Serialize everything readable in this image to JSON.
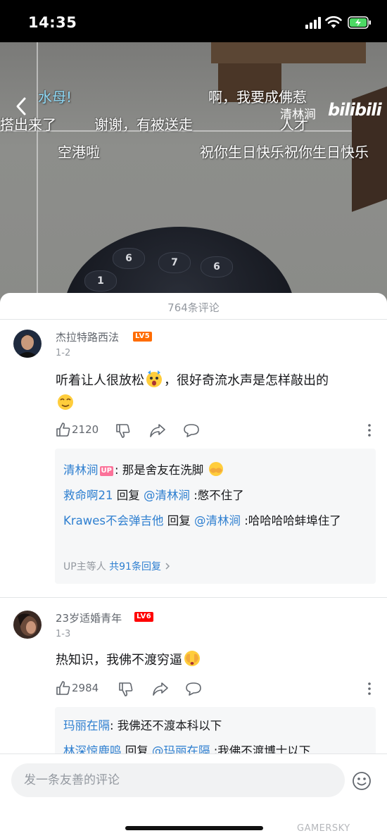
{
  "status_bar": {
    "time": "14:35"
  },
  "video": {
    "channel_name": "清林涧",
    "logo_text": "bilibili",
    "drum_numbers": [
      "1",
      "6",
      "7",
      "6"
    ],
    "danmaku": [
      {
        "text": "水母!",
        "color": "#8ed8f5"
      },
      {
        "text": "啊，我要成佛惹",
        "color": "#ffffff"
      },
      {
        "text": "搭出来了",
        "color": "#ffffff"
      },
      {
        "text": "谢谢，有被送走",
        "color": "#ffffff"
      },
      {
        "text": "人才",
        "color": "#ffffff"
      },
      {
        "text": "空港啦",
        "color": "#ffffff"
      },
      {
        "text": "祝你生日快乐祝你生日快乐",
        "color": "#ffffff"
      }
    ]
  },
  "panel": {
    "title": "764条评论"
  },
  "comments": [
    {
      "username": "杰拉特路西法",
      "level": "LV5",
      "floor": "1-2",
      "text_line1": "听着让人很放松",
      "text_line1b": "，很好奇流水声是怎样敲出的",
      "likes": "2120",
      "replies": [
        {
          "name": "清林涧",
          "badge": "UP",
          "text": ": 那是舍友在洗脚"
        },
        {
          "name": "救命啊21",
          "reply_word": " 回复 ",
          "at": "@清林涧",
          "text": " :憋不住了"
        },
        {
          "name": "Krawes不会弹吉他",
          "reply_word": " 回复 ",
          "at": "@清林涧",
          "text": " :哈哈哈哈蚌埠住了"
        }
      ],
      "more_prefix": "UP主等人 ",
      "more_link": "共91条回复"
    },
    {
      "username": "23岁适婚青年",
      "level": "LV6",
      "floor": "1-3",
      "text_line1": "热知识，我佛不渡穷逼",
      "likes": "2984",
      "replies": [
        {
          "name": "玛丽在隔",
          "text": ": 我佛还不渡本科以下"
        },
        {
          "name": "林深惊鹿鸣",
          "reply_word": " 回复 ",
          "at": "@玛丽在隔",
          "text": " :我佛不渡博士以下"
        }
      ]
    }
  ],
  "input": {
    "placeholder": "发一条友善的评论"
  },
  "watermark": "GAMERSKY",
  "colors": {
    "lv5": "#ff6c00",
    "lv6": "#ff0000",
    "link_blue": "#2e7fd0",
    "up_pink": "#fb7299"
  }
}
